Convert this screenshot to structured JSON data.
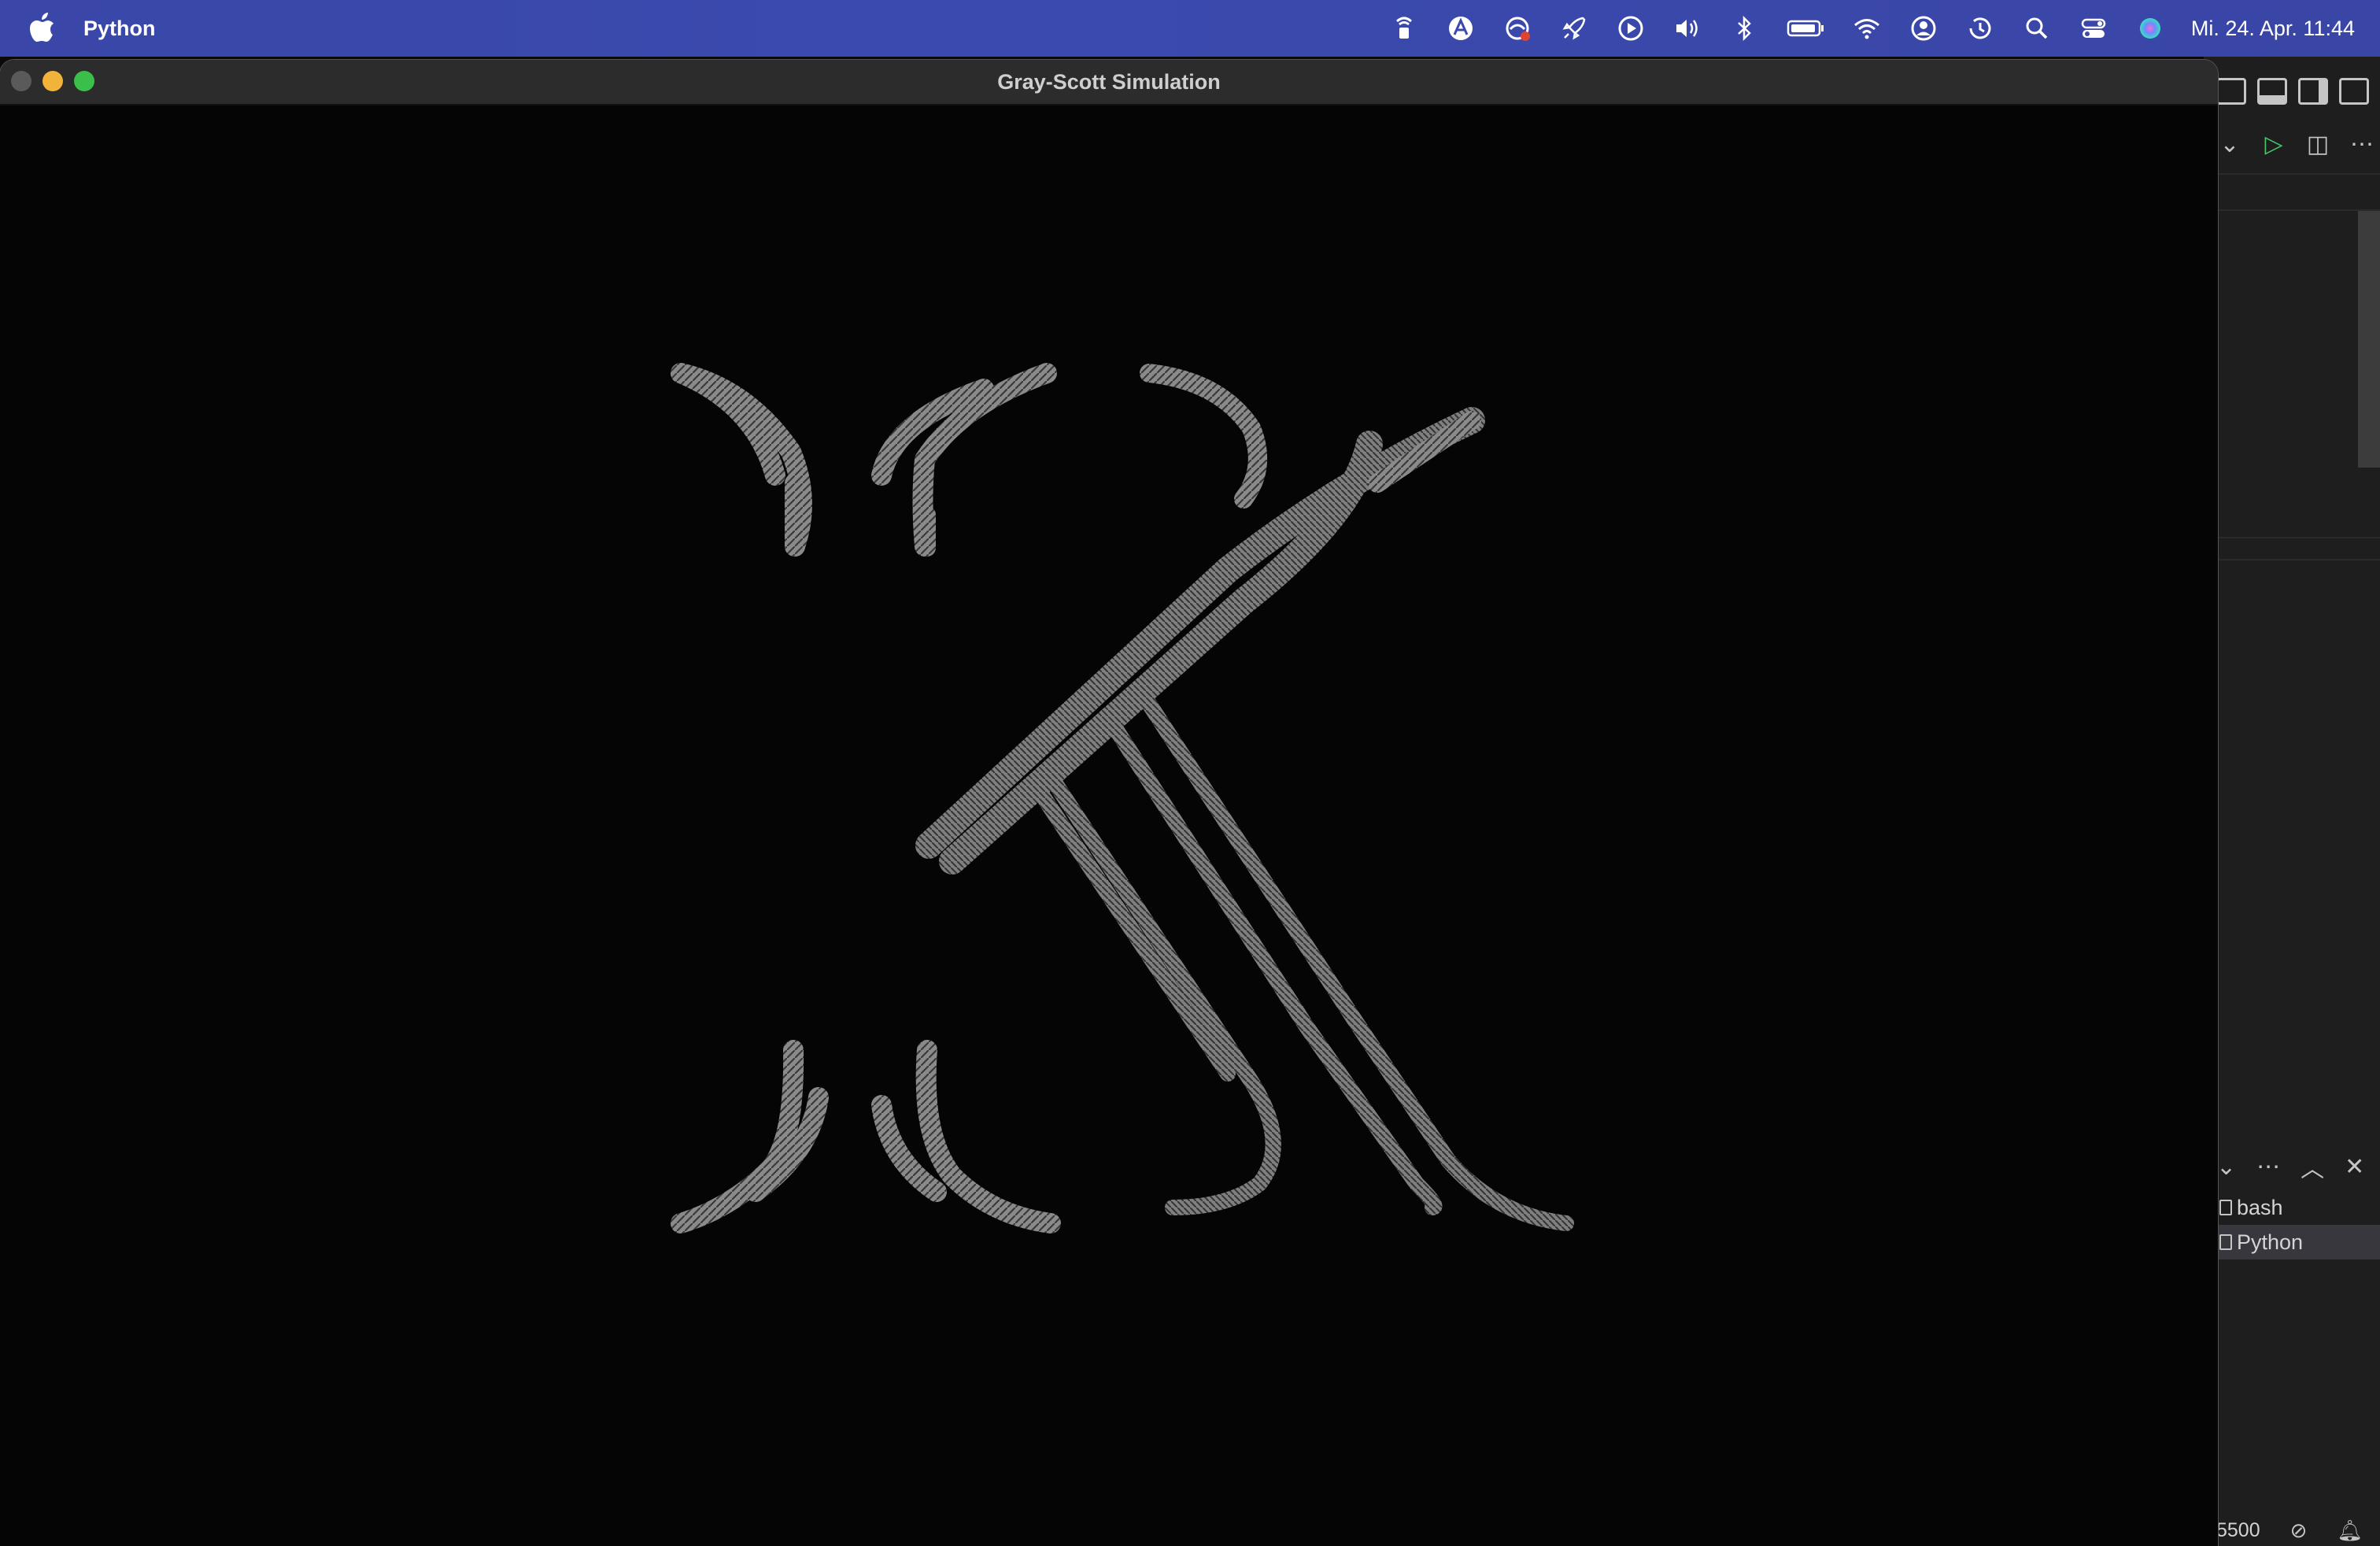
{
  "menubar": {
    "app_name": "Python",
    "clock": "Mi. 24. Apr.  11:44",
    "status_icons": [
      "airdrop-lock-icon",
      "alt-app-icon",
      "cloud-sync-icon",
      "rocket-icon",
      "play-icon",
      "volume-icon",
      "bluetooth-icon",
      "battery-icon",
      "wifi-icon",
      "user-icon",
      "time-machine-icon",
      "spotlight-search-icon",
      "control-center-icon",
      "siri-icon"
    ]
  },
  "window": {
    "title": "Gray-Scott Simulation"
  },
  "editor": {
    "terminals": [
      "bash",
      "Python"
    ],
    "active_terminal": "Python",
    "status_port": "5500"
  },
  "colors": {
    "pattern": "#8a8a8a",
    "canvas_bg": "#050505",
    "menubar": "#3b4aaf"
  }
}
